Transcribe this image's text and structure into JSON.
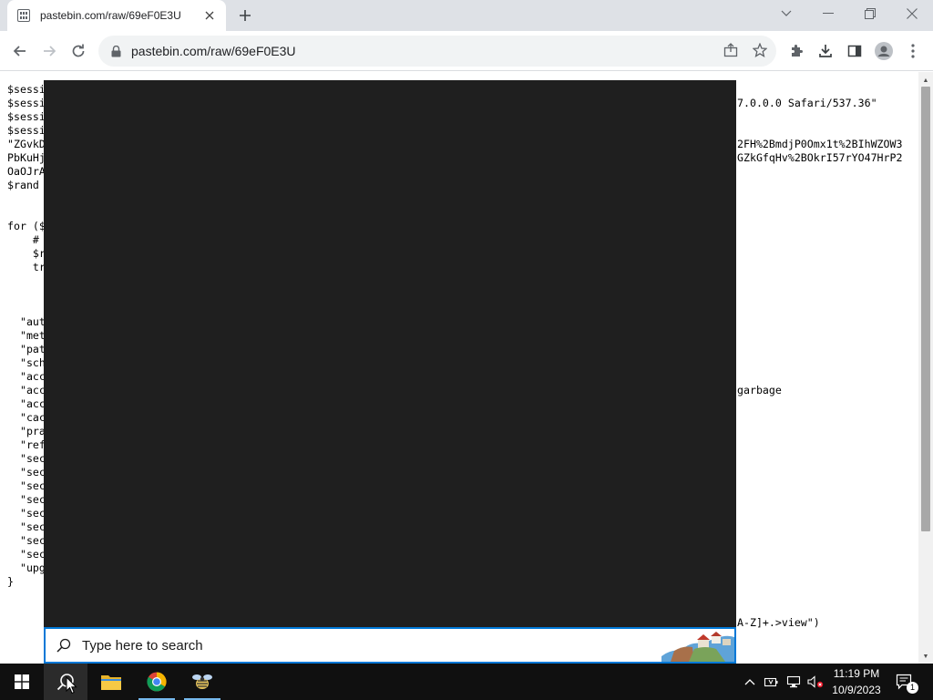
{
  "browser": {
    "tab_title": "pastebin.com/raw/69eF0E3U",
    "url": "pastebin.com/raw/69eF0E3U",
    "accent_color": "#1a73e8"
  },
  "code_left": [
    "$sessi",
    "$sessi",
    "$sessi",
    "$sessi",
    "\"ZGvkD",
    "PbKuHj",
    "OaOJrA",
    "$rand",
    "",
    "",
    "for ($",
    "    #",
    "    $r",
    "    tr",
    "",
    "",
    "",
    "  \"aut",
    "  \"met",
    "  \"pat",
    "  \"sch",
    "  \"acc",
    "  \"acc",
    "  \"acc",
    "  \"cac",
    "  \"pra",
    "  \"ref",
    "  \"sec",
    "  \"sec",
    "  \"sec",
    "  \"sec",
    "  \"sec",
    "  \"sec",
    "  \"sec",
    "  \"sec",
    "  \"upg",
    "}"
  ],
  "code_right": [
    "",
    "7.0.0.0 Safari/537.36\"",
    "",
    "",
    "2FH%2BmdjP0Omx1t%2BIhWZOW3",
    "GZkGfqHv%2BOkrI57rYO47HrP2",
    "",
    "",
    "",
    "",
    "",
    "",
    "",
    "",
    "",
    "",
    "",
    "",
    "",
    "",
    "",
    "",
    "garbage",
    "",
    "",
    "",
    "",
    "",
    "",
    "",
    "",
    "",
    "",
    "",
    "",
    "",
    "",
    "",
    "",
    "A-Z]+.>view\")"
  ],
  "search": {
    "placeholder": "Type here to search",
    "panel_color": "#1f1f1f",
    "border_color": "#0078d7"
  },
  "taskbar": {
    "time": "11:19 PM",
    "date": "10/9/2023",
    "notification_count": "1",
    "pinned": [
      "start-button",
      "search-button",
      "file-explorer-icon",
      "chrome-icon",
      "app-icon"
    ]
  }
}
